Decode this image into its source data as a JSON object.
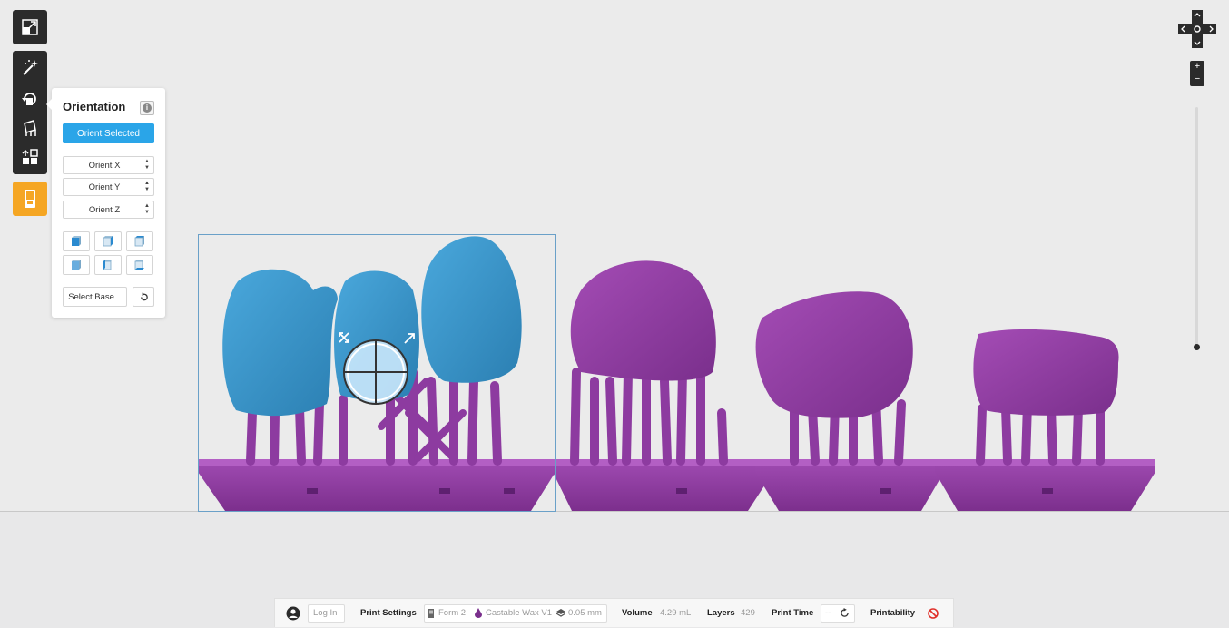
{
  "toolbar": {
    "tools": [
      {
        "name": "layout",
        "icon": "expand-icon"
      },
      {
        "name": "magic",
        "icon": "magic-wand-icon"
      },
      {
        "name": "orientation",
        "icon": "rotate-icon"
      },
      {
        "name": "supports",
        "icon": "supports-icon"
      },
      {
        "name": "layout-arrange",
        "icon": "arrange-icon"
      },
      {
        "name": "print",
        "icon": "printer-icon"
      }
    ]
  },
  "orientation_panel": {
    "title": "Orientation",
    "orient_selected": "Orient Selected",
    "orient_x": "Orient X",
    "orient_y": "Orient Y",
    "orient_z": "Orient Z",
    "select_base": "Select Base..."
  },
  "status_bar": {
    "login_label": "Log In",
    "print_settings_label": "Print Settings",
    "printer": "Form 2",
    "material": "Castable Wax V1",
    "layer_height": "0.05 mm",
    "volume_label": "Volume",
    "volume_value": "4.29 mL",
    "layers_label": "Layers",
    "layers_value": "429",
    "print_time_label": "Print Time",
    "print_time_value": "--",
    "printability_label": "Printability"
  },
  "colors": {
    "selected_model": "#3a94c8",
    "unselected_model": "#8e3aa0",
    "accent_blue": "#2aa5e8",
    "accent_orange": "#f5a623",
    "toolbar_dark": "#2b2b2b"
  }
}
